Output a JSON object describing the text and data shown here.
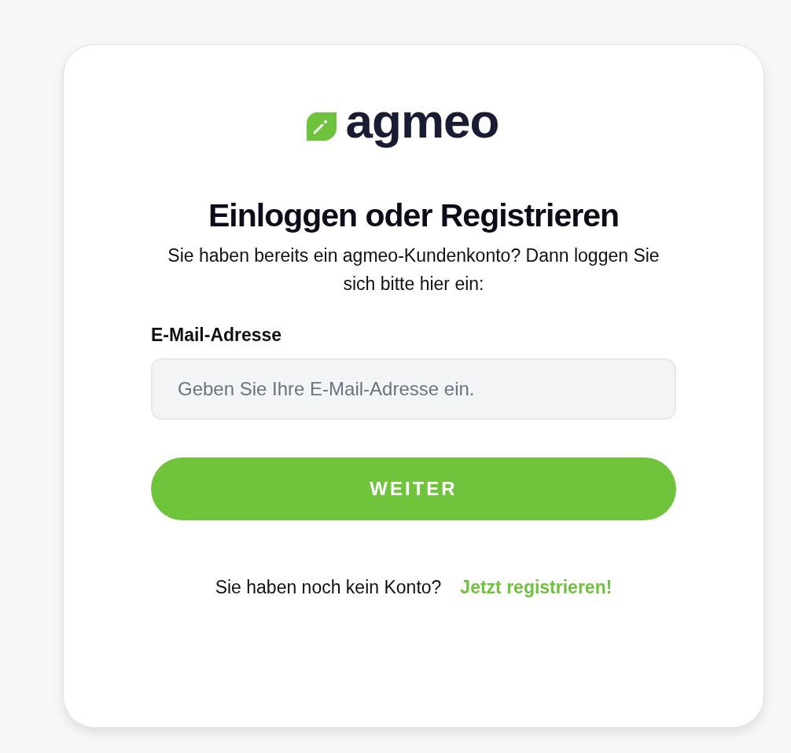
{
  "logo": {
    "text": "agmeo"
  },
  "title": "Einloggen oder Registrieren",
  "intro": "Sie haben bereits ein agmeo-Kundenkonto? Dann loggen Sie sich bitte hier ein:",
  "email": {
    "label": "E-Mail-Adresse",
    "placeholder": "Geben Sie Ihre E-Mail-Adresse ein."
  },
  "submit": "WEITER",
  "register": {
    "prompt": "Sie haben noch kein Konto?",
    "link": "Jetzt registrieren!"
  }
}
